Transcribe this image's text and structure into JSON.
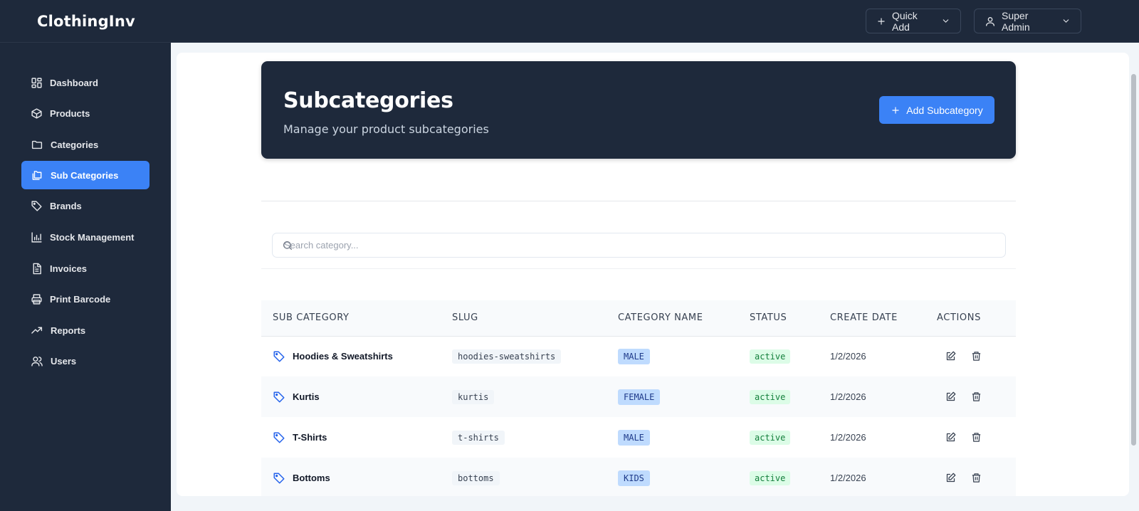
{
  "app": {
    "brand": "ClothingInv"
  },
  "topbar": {
    "quick_add_label": "Quick Add",
    "user_label": "Super Admin"
  },
  "sidebar": {
    "items": [
      {
        "label": "Dashboard",
        "icon": "layout-grid-icon",
        "active": false
      },
      {
        "label": "Products",
        "icon": "box-icon",
        "active": false
      },
      {
        "label": "Categories",
        "icon": "folder-icon",
        "active": false
      },
      {
        "label": "Sub Categories",
        "icon": "folders-icon",
        "active": true
      },
      {
        "label": "Brands",
        "icon": "tag-icon",
        "active": false
      },
      {
        "label": "Stock Management",
        "icon": "bar-chart-icon",
        "active": false
      },
      {
        "label": "Invoices",
        "icon": "file-text-icon",
        "active": false
      },
      {
        "label": "Print Barcode",
        "icon": "printer-icon",
        "active": false
      },
      {
        "label": "Reports",
        "icon": "trending-up-icon",
        "active": false
      },
      {
        "label": "Users",
        "icon": "users-icon",
        "active": false
      }
    ]
  },
  "page": {
    "title": "Subcategories",
    "subtitle": "Manage your product subcategories",
    "add_button_label": "Add Subcategory"
  },
  "search": {
    "placeholder": "Search category..."
  },
  "table": {
    "headers": [
      "SUB CATEGORY",
      "SLUG",
      "CATEGORY NAME",
      "STATUS",
      "CREATE DATE",
      "ACTIONS"
    ],
    "rows": [
      {
        "name": "Hoodies & Sweatshirts",
        "slug": "hoodies-sweatshirts",
        "category": "MALE",
        "status": "active",
        "date": "1/2/2026"
      },
      {
        "name": "Kurtis",
        "slug": "kurtis",
        "category": "FEMALE",
        "status": "active",
        "date": "1/2/2026"
      },
      {
        "name": "T-Shirts",
        "slug": "t-shirts",
        "category": "MALE",
        "status": "active",
        "date": "1/2/2026"
      },
      {
        "name": "Bottoms",
        "slug": "bottoms",
        "category": "KIDS",
        "status": "active",
        "date": "1/2/2026"
      }
    ]
  },
  "colors": {
    "sidebar_bg": "#1e293b",
    "accent": "#3b82f6",
    "category_badge": "#bfdbfe",
    "status_badge": "#dcfce7"
  }
}
